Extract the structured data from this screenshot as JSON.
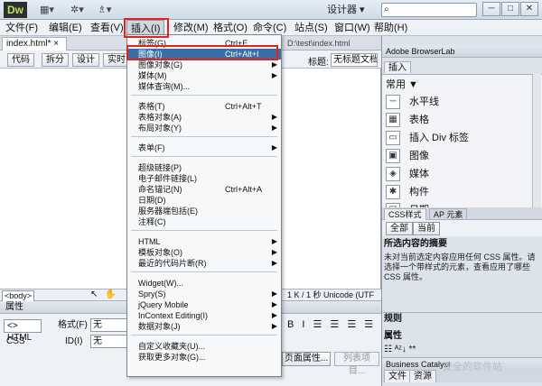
{
  "app": {
    "logo": "Dw",
    "workspace": "设计器 ▾"
  },
  "window": {
    "minimize": "─",
    "maximize": "□",
    "close": "✕"
  },
  "menubar": [
    "文件(F)",
    "编辑(E)",
    "查看(V)",
    "插入(I)",
    "修改(M)",
    "格式(O)",
    "命令(C)",
    "站点(S)",
    "窗口(W)",
    "帮助(H)"
  ],
  "doc": {
    "tab": "index.html* ×",
    "path": "D:\\test\\index.html",
    "views": [
      "代码",
      "拆分",
      "设计",
      "实时"
    ],
    "title_label": "标题:",
    "title_value": "无标题文档"
  },
  "status": {
    "tag": "<body>",
    "info": "1 K / 1 秒 Unicode (UTF"
  },
  "properties": {
    "title": "属性",
    "html_btn": "<> HTML",
    "css_btn": "CSS",
    "format_label": "格式(F)",
    "format_value": "无",
    "id_label": "ID(I)",
    "id_value": "无",
    "page_props": "页面属性...",
    "list_item": "列表项目..."
  },
  "right": {
    "browserlab": "Adobe BrowserLab",
    "insert_tab": "插入",
    "category": "常用 ▼",
    "insert_items": [
      {
        "icon": "hr-icon",
        "label": "水平线"
      },
      {
        "icon": "table-icon",
        "label": "表格"
      },
      {
        "icon": "div-icon",
        "label": "插入 Div 标签"
      },
      {
        "icon": "image-icon",
        "label": "图像"
      },
      {
        "icon": "media-icon",
        "label": "媒体"
      },
      {
        "icon": "widget-icon",
        "label": "构件"
      },
      {
        "icon": "date-icon",
        "label": "日期"
      }
    ],
    "css_tabs": [
      "CSS样式",
      "AP 元素"
    ],
    "css_modes": [
      "全部",
      "当前"
    ],
    "css_summary_title": "所选内容的摘要",
    "css_summary_text": "未对当前选定内容应用任何 CSS 属性。请选择一个带样式的元素，查看应用了哪些 CSS 属性。",
    "rules": "规则",
    "attributes": "属性",
    "bl_footer": "Business Catalyst",
    "file_tabs": [
      "文件",
      "资源"
    ],
    "watermark": "安全的软件站"
  },
  "insert_menu": [
    {
      "label": "标签(G)...",
      "shortcut": "Ctrl+E",
      "arrow": ""
    },
    {
      "label": "图像(I)",
      "shortcut": "Ctrl+Alt+I",
      "arrow": "",
      "selected": true
    },
    {
      "label": "图像对象(G)",
      "shortcut": "",
      "arrow": "▶"
    },
    {
      "label": "媒体(M)",
      "shortcut": "",
      "arrow": "▶"
    },
    {
      "label": "媒体查询(M)...",
      "shortcut": "",
      "arrow": ""
    },
    {
      "label": "表格(T)",
      "shortcut": "Ctrl+Alt+T",
      "arrow": ""
    },
    {
      "label": "表格对象(A)",
      "shortcut": "",
      "arrow": "▶"
    },
    {
      "label": "布局对象(Y)",
      "shortcut": "",
      "arrow": "▶"
    },
    {
      "label": "表单(F)",
      "shortcut": "",
      "arrow": "▶"
    },
    {
      "label": "超级链接(P)",
      "shortcut": "",
      "arrow": ""
    },
    {
      "label": "电子邮件链接(L)",
      "shortcut": "",
      "arrow": ""
    },
    {
      "label": "命名锚记(N)",
      "shortcut": "Ctrl+Alt+A",
      "arrow": ""
    },
    {
      "label": "日期(D)",
      "shortcut": "",
      "arrow": ""
    },
    {
      "label": "服务器端包括(E)",
      "shortcut": "",
      "arrow": ""
    },
    {
      "label": "注释(C)",
      "shortcut": "",
      "arrow": ""
    },
    {
      "label": "HTML",
      "shortcut": "",
      "arrow": "▶"
    },
    {
      "label": "模板对象(O)",
      "shortcut": "",
      "arrow": "▶"
    },
    {
      "label": "最近的代码片断(R)",
      "shortcut": "",
      "arrow": "▶"
    },
    {
      "label": "Widget(W)...",
      "shortcut": "",
      "arrow": ""
    },
    {
      "label": "Spry(S)",
      "shortcut": "",
      "arrow": "▶"
    },
    {
      "label": "jQuery Mobile",
      "shortcut": "",
      "arrow": "▶"
    },
    {
      "label": "InContext Editing(I)",
      "shortcut": "",
      "arrow": "▶"
    },
    {
      "label": "数据对象(J)",
      "shortcut": "",
      "arrow": "▶"
    },
    {
      "label": "自定义收藏夹(U)...",
      "shortcut": "",
      "arrow": ""
    },
    {
      "label": "获取更多对象(G)...",
      "shortcut": "",
      "arrow": ""
    }
  ]
}
